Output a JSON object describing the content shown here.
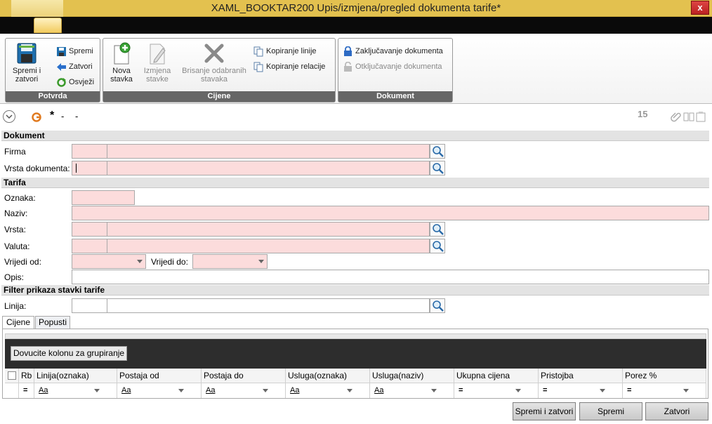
{
  "window": {
    "title": "XAML_BOOKTAR200  Upis/izmjena/pregled dokumenta tarife*",
    "close_glyph": "x"
  },
  "ribbon": {
    "potvrda": {
      "label": "Potvrda",
      "save_close": "Spremi i zatvori",
      "save": "Spremi",
      "close": "Zatvori",
      "refresh": "Osvježi"
    },
    "cijene": {
      "label": "Cijene",
      "new_item": "Nova stavka",
      "edit_item": "Izmjena stavke",
      "delete_items": "Brisanje odabranih stavaka",
      "copy_line": "Kopiranje linije",
      "copy_relation": "Kopiranje relacije"
    },
    "dokument": {
      "label": "Dokument",
      "lock": "Zaključavanje dokumenta",
      "unlock": "Otključavanje dokumenta"
    }
  },
  "toolbar": {
    "status_star": "*",
    "dash1": "-",
    "dash2": "-",
    "count": "15"
  },
  "sections": {
    "dokument": "Dokument",
    "tarifa": "Tarifa",
    "filter": "Filter prikaza stavki tarife"
  },
  "fields": {
    "firma": "Firma",
    "vrsta_dokumenta": "Vrsta dokumenta:",
    "oznaka": "Oznaka:",
    "naziv": "Naziv:",
    "vrsta": "Vrsta:",
    "valuta": "Valuta:",
    "vrijedi_od": "Vrijedi od:",
    "vrijedi_do": "Vrijedi do:",
    "opis": "Opis:",
    "linija": "Linija:"
  },
  "tabs": [
    "Cijene",
    "Popusti"
  ],
  "grid": {
    "group_hint": "Dovucite kolonu za grupiranje",
    "columns": [
      "Rb",
      "Linija(oznaka)",
      "Postaja od",
      "Postaja do",
      "Usluga(oznaka)",
      "Usluga(naziv)",
      "Ukupna cijena",
      "Pristojba",
      "Porez %"
    ],
    "filters": [
      "=",
      "Aa",
      "Aa",
      "Aa",
      "Aa",
      "Aa",
      "=",
      "=",
      "="
    ]
  },
  "footer": {
    "save_close": "Spremi i zatvori",
    "save": "Spremi",
    "close": "Zatvori"
  }
}
